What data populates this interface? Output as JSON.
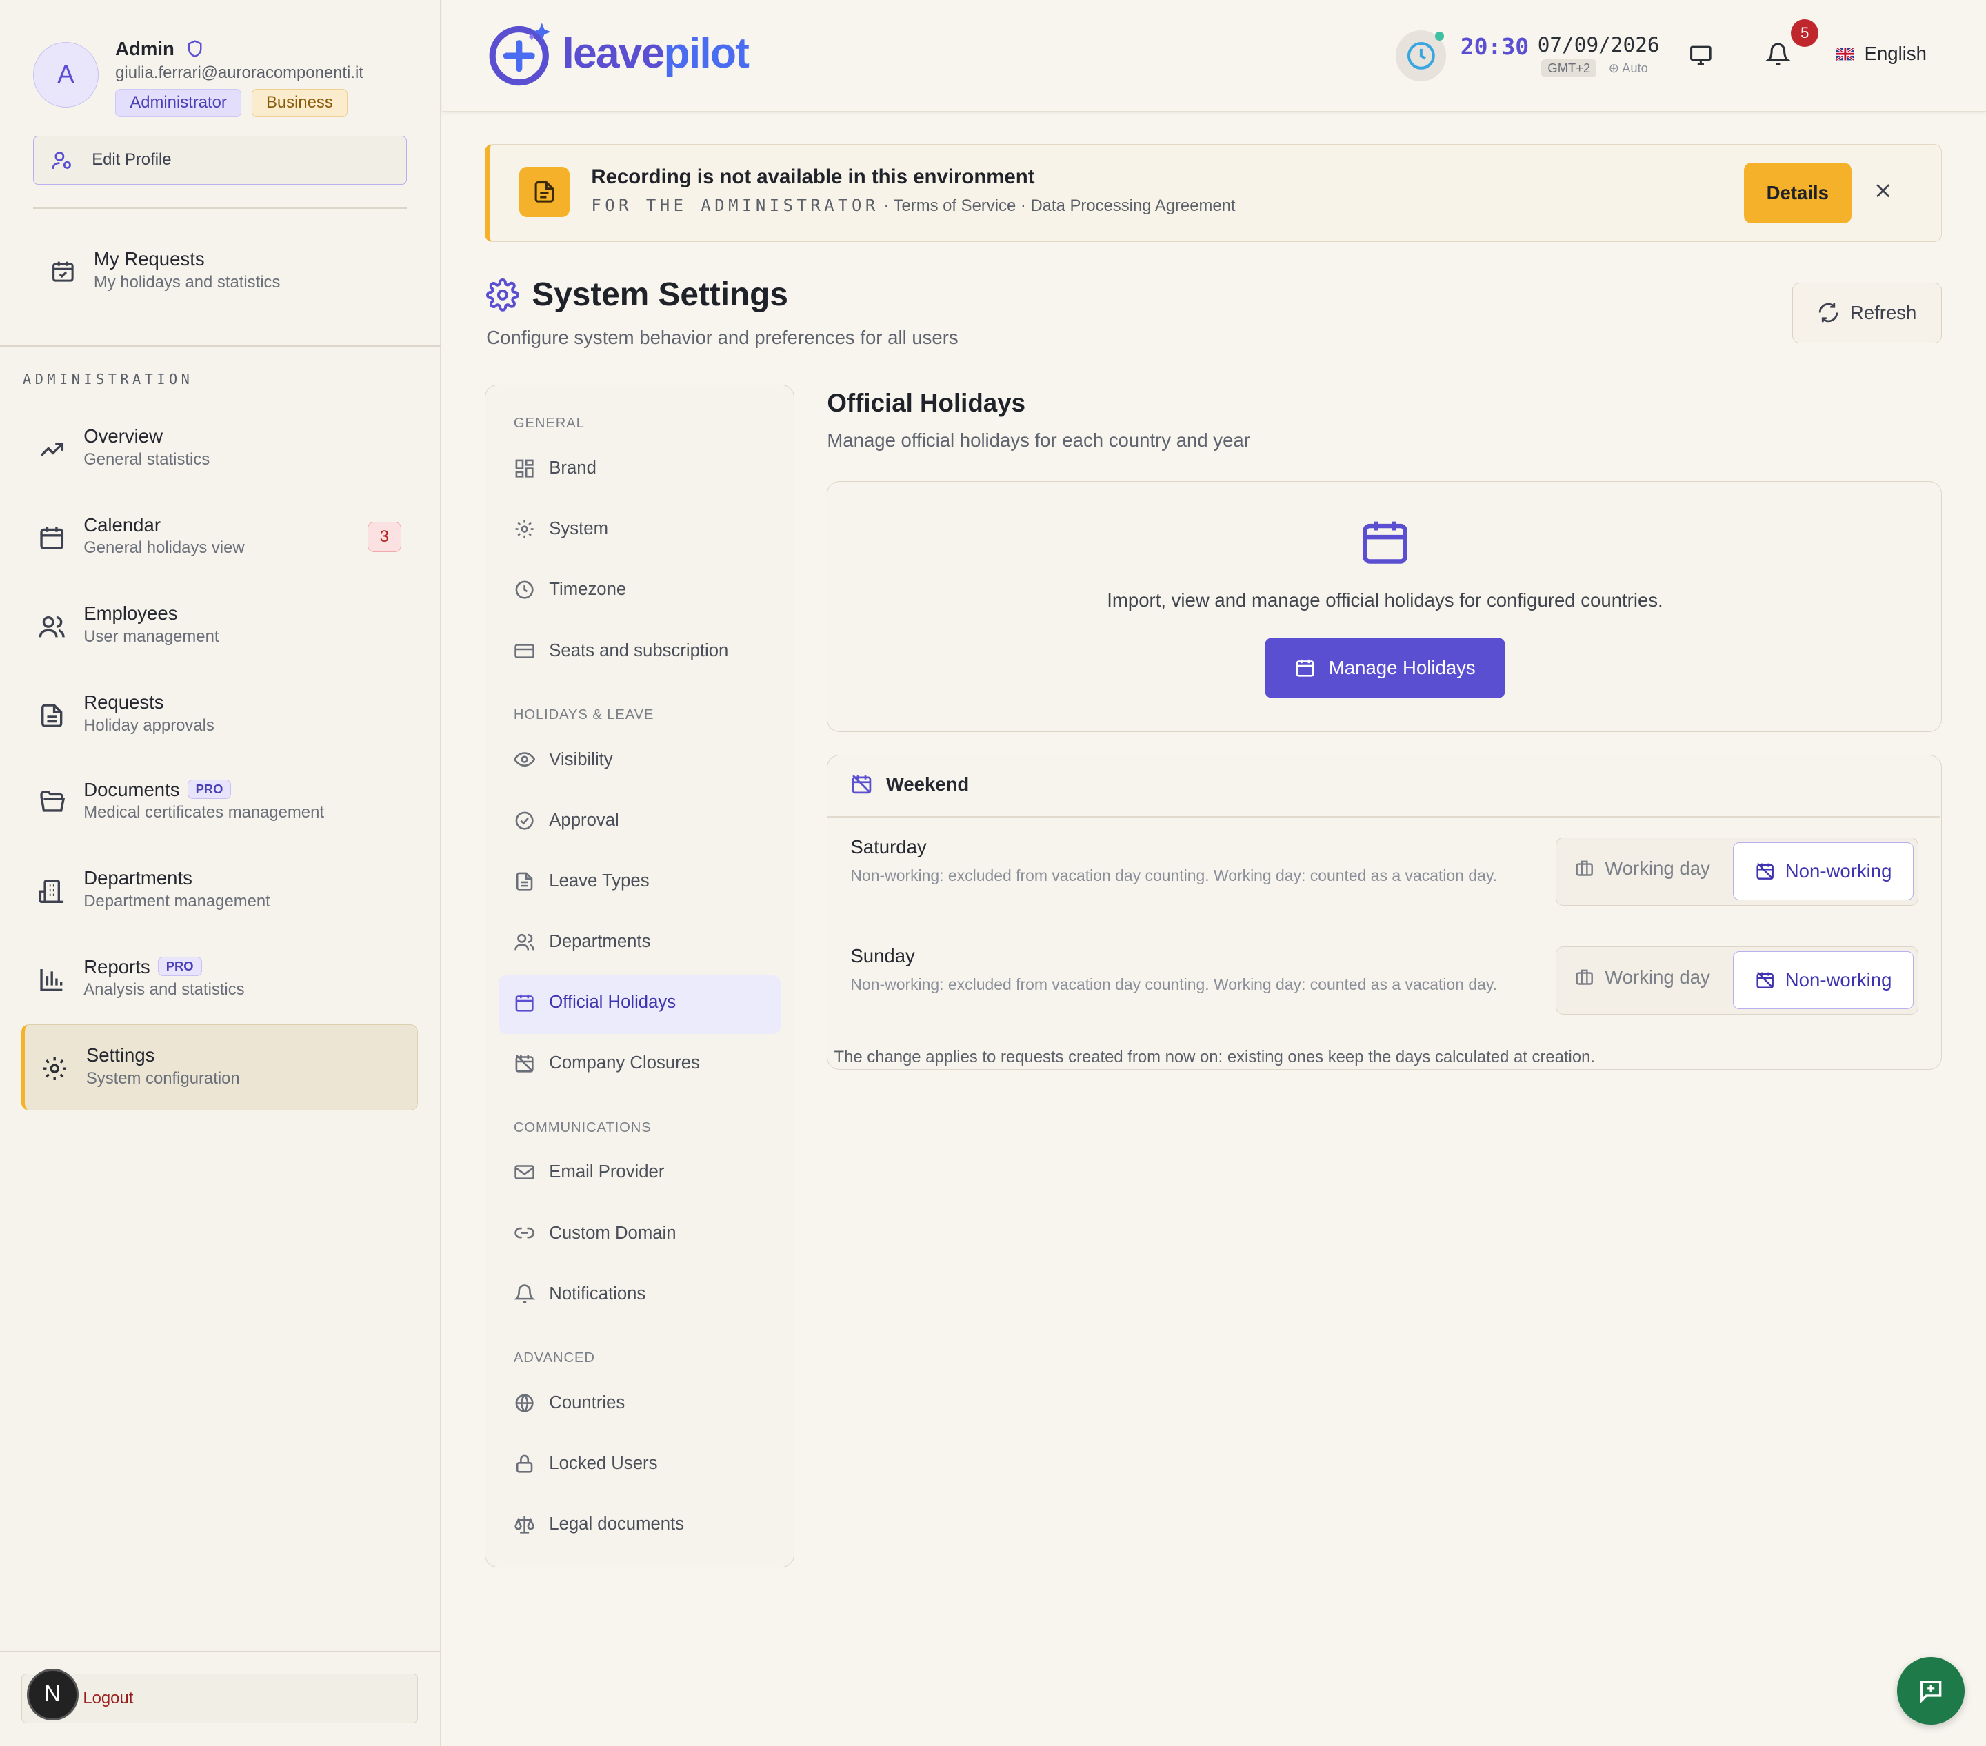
{
  "profile": {
    "initial": "A",
    "name": "Admin",
    "email": "giulia.ferrari@auroracomponenti.it",
    "role": "Administrator",
    "plan": "Business",
    "edit_label": "Edit Profile"
  },
  "sidebar": {
    "my_requests": {
      "title": "My Requests",
      "subtitle": "My holidays and statistics"
    },
    "admin_section": "ADMINISTRATION",
    "items": [
      {
        "title": "Overview",
        "subtitle": "General statistics"
      },
      {
        "title": "Calendar",
        "subtitle": "General holidays view",
        "count": "3"
      },
      {
        "title": "Employees",
        "subtitle": "User management"
      },
      {
        "title": "Requests",
        "subtitle": "Holiday approvals"
      },
      {
        "title": "Documents",
        "subtitle": "Medical certificates management",
        "badge": "PRO"
      },
      {
        "title": "Departments",
        "subtitle": "Department management"
      },
      {
        "title": "Reports",
        "subtitle": "Analysis and statistics",
        "badge": "PRO"
      },
      {
        "title": "Settings",
        "subtitle": "System configuration"
      }
    ],
    "logout_label": "Logout",
    "n_badge": "N"
  },
  "header": {
    "logo_part1": "leave",
    "logo_part2": "pilot",
    "time": "20:30",
    "date": "07/09/2026",
    "tz": "GMT+2",
    "tz_mode": "Auto",
    "notifications_count": "5",
    "language": "English"
  },
  "banner": {
    "title": "Recording is not available in this environment",
    "for_label": "FOR THE ADMINISTRATOR",
    "links": [
      "Terms of Service",
      "Data Processing Agreement"
    ],
    "details_label": "Details"
  },
  "page": {
    "title": "System Settings",
    "subtitle": "Configure system behavior and preferences for all users",
    "refresh_label": "Refresh"
  },
  "settings_nav": {
    "groups": [
      {
        "label": "GENERAL",
        "items": [
          "Brand",
          "System",
          "Timezone",
          "Seats and subscription"
        ]
      },
      {
        "label": "HOLIDAYS & LEAVE",
        "items": [
          "Visibility",
          "Approval",
          "Leave Types",
          "Departments",
          "Official Holidays",
          "Company Closures"
        ]
      },
      {
        "label": "COMMUNICATIONS",
        "items": [
          "Email Provider",
          "Custom Domain",
          "Notifications"
        ]
      },
      {
        "label": "ADVANCED",
        "items": [
          "Countries",
          "Locked Users",
          "Legal documents"
        ]
      }
    ],
    "active": "Official Holidays"
  },
  "holidays": {
    "title": "Official Holidays",
    "subtitle": "Manage official holidays for each country and year",
    "description": "Import, view and manage official holidays for configured countries.",
    "button": "Manage Holidays"
  },
  "weekend": {
    "title": "Weekend",
    "days": [
      {
        "name": "Saturday",
        "desc": "Non-working: excluded from vacation day counting. Working day: counted as a vacation day.",
        "option_working": "Working day",
        "option_nonworking": "Non-working",
        "selected": "Non-working"
      },
      {
        "name": "Sunday",
        "desc": "Non-working: excluded from vacation day counting. Working day: counted as a vacation day.",
        "option_working": "Working day",
        "option_nonworking": "Non-working",
        "selected": "Non-working"
      }
    ],
    "note": "The change applies to requests created from now on: existing ones keep the days calculated at creation."
  },
  "colors": {
    "accent": "#5b4fd1",
    "warning": "#f6b12b",
    "chat": "#1f7a4a"
  }
}
